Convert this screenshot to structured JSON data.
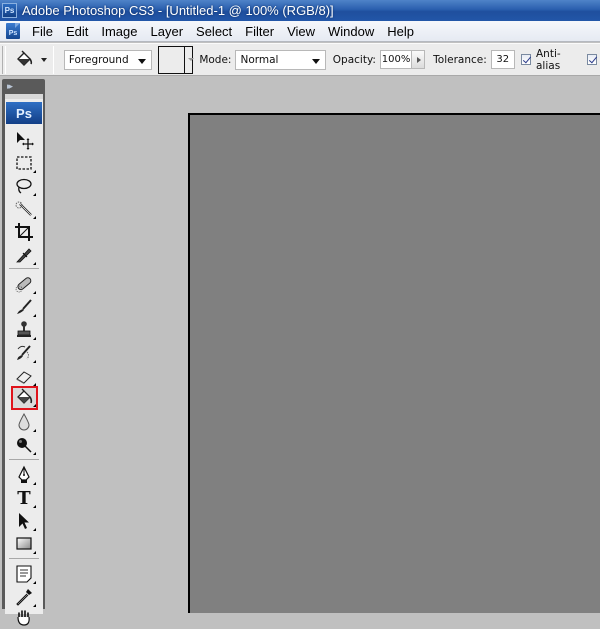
{
  "titlebar": {
    "app_icon": "ps-icon",
    "app_icon_text": "Ps",
    "title": "Adobe Photoshop CS3 - [Untitled-1 @ 100% (RGB/8)]"
  },
  "menubar": {
    "doc_icon": "photoshop-document-icon",
    "doc_icon_text": "Ps",
    "items": [
      {
        "label": "File"
      },
      {
        "label": "Edit"
      },
      {
        "label": "Image"
      },
      {
        "label": "Layer"
      },
      {
        "label": "Select"
      },
      {
        "label": "Filter"
      },
      {
        "label": "View"
      },
      {
        "label": "Window"
      },
      {
        "label": "Help"
      }
    ]
  },
  "options_bar": {
    "tool_preset_icon": "paint-bucket-icon",
    "fill_source": "Foreground",
    "mode_label": "Mode:",
    "mode_value": "Normal",
    "opacity_label": "Opacity:",
    "opacity_value": "100%",
    "tolerance_label": "Tolerance:",
    "tolerance_value": "32",
    "anti_alias_label": "Anti-alias",
    "anti_alias_checked": true,
    "contiguous_checked": true
  },
  "toolbox": {
    "logo_text": "Ps",
    "collapse_glyph": "▸▸",
    "tools": [
      {
        "name": "move-tool",
        "icon": "move-icon"
      },
      {
        "name": "marquee-tool",
        "icon": "rectangular-marquee-icon"
      },
      {
        "name": "lasso-tool",
        "icon": "lasso-icon"
      },
      {
        "name": "quick-selection-tool",
        "icon": "quick-selection-icon"
      },
      {
        "name": "crop-tool",
        "icon": "crop-icon"
      },
      {
        "name": "slice-tool",
        "icon": "slice-icon"
      },
      {
        "name": "healing-brush-tool",
        "icon": "healing-brush-icon"
      },
      {
        "name": "brush-tool",
        "icon": "brush-icon"
      },
      {
        "name": "clone-stamp-tool",
        "icon": "clone-stamp-icon"
      },
      {
        "name": "history-brush-tool",
        "icon": "history-brush-icon"
      },
      {
        "name": "eraser-tool",
        "icon": "eraser-icon"
      },
      {
        "name": "paint-bucket-tool",
        "icon": "paint-bucket-icon",
        "selected": true
      },
      {
        "name": "blur-tool",
        "icon": "blur-drop-icon"
      },
      {
        "name": "dodge-tool",
        "icon": "dodge-icon"
      },
      {
        "name": "pen-tool",
        "icon": "pen-icon"
      },
      {
        "name": "type-tool",
        "icon": "type-icon",
        "glyph": "T"
      },
      {
        "name": "path-selection-tool",
        "icon": "path-selection-arrow-icon"
      },
      {
        "name": "shape-tool",
        "icon": "rectangle-shape-icon"
      },
      {
        "name": "notes-tool",
        "icon": "notes-icon"
      },
      {
        "name": "eyedropper-tool",
        "icon": "eyedropper-icon"
      },
      {
        "name": "hand-tool",
        "icon": "hand-icon"
      }
    ]
  },
  "canvas": {
    "background_color": "#808080",
    "workspace_color": "#c0c0c0"
  },
  "colors": {
    "selection_highlight": "#e0141c",
    "title_bar": "#2a5fae"
  }
}
